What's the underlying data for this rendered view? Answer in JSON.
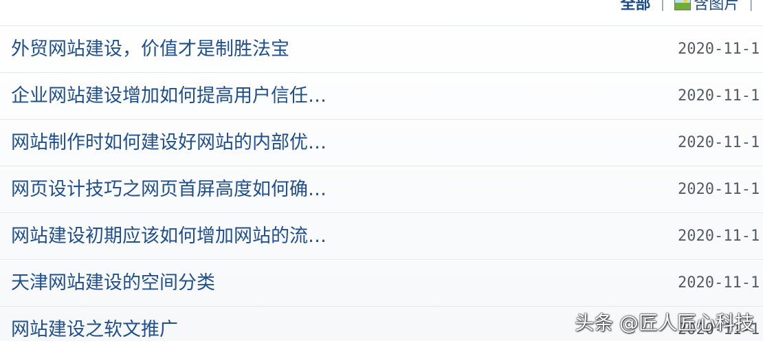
{
  "filter": {
    "all_label": "全部",
    "separator": "|",
    "images_label": "含图片"
  },
  "news": [
    {
      "title": "外贸网站建设，价值才是制胜法宝",
      "date": "2020-11-1"
    },
    {
      "title": "企业网站建设增加如何提高用户信任…",
      "date": "2020-11-1"
    },
    {
      "title": "网站制作时如何建设好网站的内部优…",
      "date": "2020-11-1"
    },
    {
      "title": "网页设计技巧之网页首屏高度如何确…",
      "date": "2020-11-1"
    },
    {
      "title": "网站建设初期应该如何增加网站的流…",
      "date": "2020-11-1"
    },
    {
      "title": "天津网站建设的空间分类",
      "date": "2020-11-1"
    },
    {
      "title": "网站建设之软文推广",
      "date": "2020-11-1"
    }
  ],
  "watermark": "头条 @匠人匠心科技",
  "colors": {
    "link": "#1f4f8e",
    "date": "#555b62",
    "divider": "#e3e8ee"
  }
}
